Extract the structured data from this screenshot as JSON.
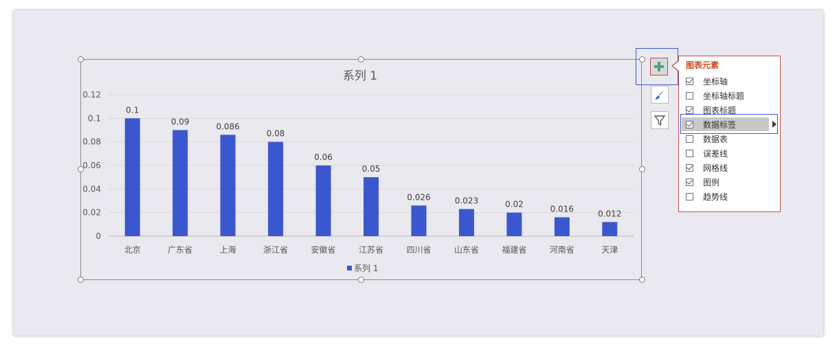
{
  "chart_data": {
    "type": "bar",
    "title": "系列 1",
    "categories": [
      "北京",
      "广东省",
      "上海",
      "浙江省",
      "安徽省",
      "江苏省",
      "四川省",
      "山东省",
      "福建省",
      "河南省",
      "天津"
    ],
    "series": [
      {
        "name": "系列 1",
        "values": [
          0.1,
          0.09,
          0.086,
          0.08,
          0.06,
          0.05,
          0.026,
          0.023,
          0.02,
          0.016,
          0.012
        ]
      }
    ],
    "data_labels": [
      "0.1",
      "0.09",
      "0.086",
      "0.08",
      "0.06",
      "0.05",
      "0.026",
      "0.023",
      "0.02",
      "0.016",
      "0.012"
    ],
    "ylim": [
      0,
      0.12
    ],
    "yticks": [
      "0",
      "0.02",
      "0.04",
      "0.06",
      "0.08",
      "0.1",
      "0.12"
    ],
    "xlabel": "",
    "ylabel": "",
    "grid": true,
    "legend": "bottom",
    "bar_color": "#3b57cf"
  },
  "chart_elements_panel": {
    "title": "图表元素",
    "items": [
      {
        "label": "坐标轴",
        "checked": true
      },
      {
        "label": "坐标轴标题",
        "checked": false
      },
      {
        "label": "图表标题",
        "checked": true
      },
      {
        "label": "数据标签",
        "checked": true,
        "hovered": true,
        "has_submenu": true
      },
      {
        "label": "数据表",
        "checked": false
      },
      {
        "label": "误差线",
        "checked": false
      },
      {
        "label": "网格线",
        "checked": true
      },
      {
        "label": "图例",
        "checked": true
      },
      {
        "label": "趋势线",
        "checked": false
      }
    ]
  },
  "side_buttons": {
    "chart_elements_icon": "plus-icon",
    "chart_styles_icon": "paintbrush-icon",
    "chart_filters_icon": "filter-icon"
  },
  "colors": {
    "accent_green": "#4aa57e",
    "panel_border": "#c0504d",
    "highlight_blue": "#3a58c9"
  }
}
